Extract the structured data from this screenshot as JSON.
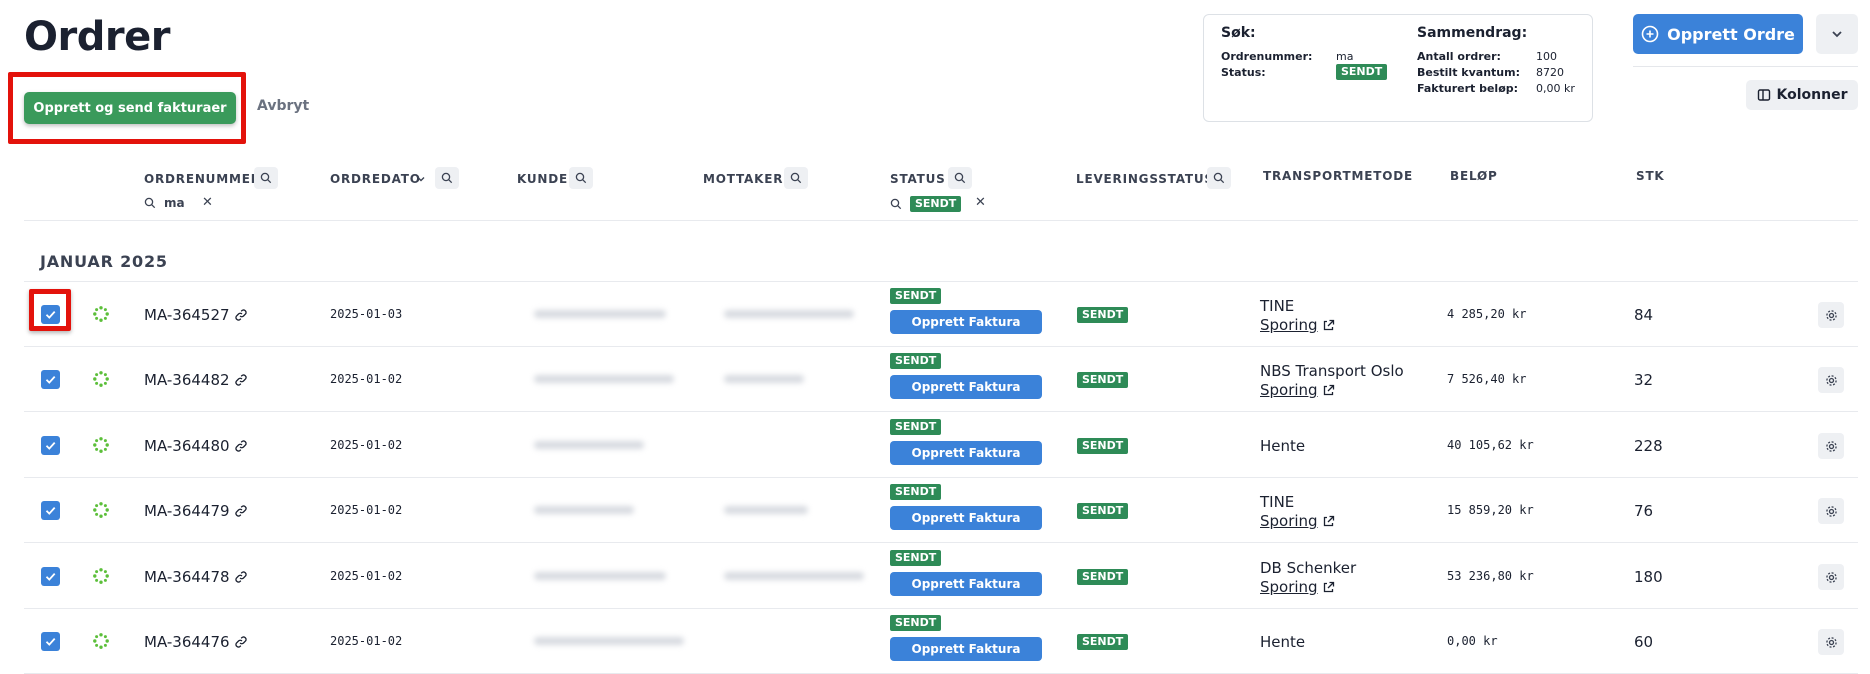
{
  "page": {
    "title": "Ordrer"
  },
  "bulk": {
    "create_send_label": "Opprett og send fakturaer",
    "cancel_label": "Avbryt"
  },
  "search_box": {
    "heading": "Søk:",
    "order_number_label": "Ordrenummer:",
    "order_number_value": "ma",
    "status_label": "Status:",
    "status_value": "SENDT"
  },
  "summary": {
    "heading": "Sammendrag:",
    "count_label": "Antall ordrer:",
    "count_value": "100",
    "qty_label": "Bestilt kvantum:",
    "qty_value": "8720",
    "invoiced_label": "Fakturert beløp:",
    "invoiced_value": "0,00 kr"
  },
  "header": {
    "create_order_label": "Opprett Ordre",
    "columns_label": "Kolonner"
  },
  "table": {
    "columns": [
      "ORDRENUMMER",
      "ORDREDATO",
      "KUNDE",
      "MOTTAKER",
      "STATUS",
      "LEVERINGSSTATUS",
      "TRANSPORTMETODE",
      "BELØP",
      "STK"
    ],
    "filters": {
      "order_number": "ma",
      "status": "SENDT"
    },
    "group_label": "JANUAR 2025",
    "invoice_button_label": "Opprett Faktura",
    "tracking_label": "Sporing",
    "rows": [
      {
        "order_no": "MA-364527",
        "date": "2025-01-03",
        "status": "SENDT",
        "delivery": "SENDT",
        "transport": "TINE",
        "tracking": true,
        "amount": "4 285,20 kr",
        "qty": "84"
      },
      {
        "order_no": "MA-364482",
        "date": "2025-01-02",
        "status": "SENDT",
        "delivery": "SENDT",
        "transport": "NBS Transport Oslo",
        "tracking": true,
        "amount": "7 526,40 kr",
        "qty": "32"
      },
      {
        "order_no": "MA-364480",
        "date": "2025-01-02",
        "status": "SENDT",
        "delivery": "SENDT",
        "transport": "Hente",
        "tracking": false,
        "amount": "40 105,62 kr",
        "qty": "228"
      },
      {
        "order_no": "MA-364479",
        "date": "2025-01-02",
        "status": "SENDT",
        "delivery": "SENDT",
        "transport": "TINE",
        "tracking": true,
        "amount": "15 859,20 kr",
        "qty": "76"
      },
      {
        "order_no": "MA-364478",
        "date": "2025-01-02",
        "status": "SENDT",
        "delivery": "SENDT",
        "transport": "DB Schenker",
        "tracking": true,
        "amount": "53 236,80 kr",
        "qty": "180"
      },
      {
        "order_no": "MA-364476",
        "date": "2025-01-02",
        "status": "SENDT",
        "delivery": "SENDT",
        "transport": "Hente",
        "tracking": false,
        "amount": "0,00 kr",
        "qty": "60"
      }
    ]
  },
  "colors": {
    "accent_blue": "#3b82d9",
    "success_green": "#2e8b57",
    "highlight_red": "#e3120b"
  }
}
